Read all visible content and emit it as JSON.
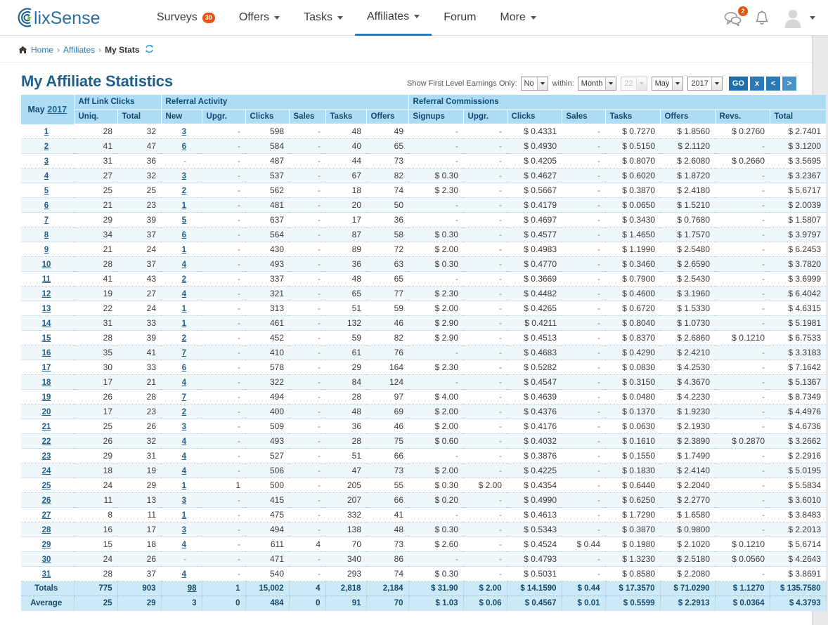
{
  "brand": {
    "name": "clixSense",
    "accent": "#2a7ab9",
    "badge_color": "#e8520e"
  },
  "nav": {
    "items": [
      {
        "label": "Surveys",
        "badge": "30",
        "caret": false,
        "active": false
      },
      {
        "label": "Offers",
        "badge": null,
        "caret": true,
        "active": false
      },
      {
        "label": "Tasks",
        "badge": null,
        "caret": true,
        "active": false
      },
      {
        "label": "Affiliates",
        "badge": null,
        "caret": true,
        "active": true
      },
      {
        "label": "Forum",
        "badge": null,
        "caret": false,
        "active": false
      },
      {
        "label": "More",
        "badge": null,
        "caret": true,
        "active": false
      }
    ],
    "chat_icon": "chat-bubbles-icon",
    "chat_count": "2",
    "bell_icon": "bell-icon",
    "avatar_icon": "user-avatar-icon"
  },
  "breadcrumb": {
    "home_icon": "home-icon",
    "home": "Home",
    "section": "Affiliates",
    "current": "My Stats",
    "refresh_icon": "refresh-icon",
    "separator": "›"
  },
  "header": {
    "title": "My Affiliate Statistics"
  },
  "filters": {
    "first_level_label": "Show First Level Earnings Only:",
    "first_level_value": "No",
    "within_label": "within:",
    "period_value": "Month",
    "day_value": "22",
    "day_disabled": true,
    "month_value": "May",
    "year_value": "2017",
    "go_label": "GO",
    "clear_label": "x",
    "prev_label": "<",
    "next_label": ">"
  },
  "table": {
    "month_label": "May",
    "year_label": "2017",
    "groups": [
      {
        "label": "Aff Link Clicks",
        "span": 2
      },
      {
        "label": "Referral Activity",
        "span": 6
      },
      {
        "label": "Referral Commissions",
        "span": 8
      }
    ],
    "columns": [
      "Uniq.",
      "Total",
      "New",
      "Upgr.",
      "Clicks",
      "Sales",
      "Tasks",
      "Offers",
      "Signups",
      "Upgr.",
      "Clicks",
      "Sales",
      "Tasks",
      "Offers",
      "Revs.",
      "Total"
    ],
    "rows": [
      {
        "day": "1",
        "cells": [
          "28",
          "32",
          "3",
          "-",
          "598",
          "-",
          "48",
          "49",
          "-",
          "-",
          "$ 0.4331",
          "-",
          "$ 0.7270",
          "$ 1.8560",
          "$ 0.2760",
          "$ 2.7401"
        ]
      },
      {
        "day": "2",
        "cells": [
          "41",
          "47",
          "6",
          "-",
          "584",
          "-",
          "40",
          "65",
          "-",
          "-",
          "$ 0.4930",
          "-",
          "$ 0.5150",
          "$ 2.1120",
          "-",
          "$ 3.1200"
        ]
      },
      {
        "day": "3",
        "cells": [
          "31",
          "36",
          "-",
          "-",
          "487",
          "-",
          "44",
          "73",
          "-",
          "-",
          "$ 0.4205",
          "-",
          "$ 0.8070",
          "$ 2.6080",
          "$ 0.2660",
          "$ 3.5695"
        ]
      },
      {
        "day": "4",
        "cells": [
          "27",
          "32",
          "3",
          "-",
          "537",
          "-",
          "67",
          "82",
          "$ 0.30",
          "-",
          "$ 0.4627",
          "-",
          "$ 0.6020",
          "$ 1.8720",
          "-",
          "$ 3.2367"
        ]
      },
      {
        "day": "5",
        "cells": [
          "25",
          "25",
          "2",
          "-",
          "562",
          "-",
          "18",
          "74",
          "$ 2.30",
          "-",
          "$ 0.5667",
          "-",
          "$ 0.3870",
          "$ 2.4180",
          "-",
          "$ 5.6717"
        ]
      },
      {
        "day": "6",
        "cells": [
          "21",
          "23",
          "1",
          "-",
          "481",
          "-",
          "20",
          "50",
          "-",
          "-",
          "$ 0.4179",
          "-",
          "$ 0.0650",
          "$ 1.5210",
          "-",
          "$ 2.0039"
        ]
      },
      {
        "day": "7",
        "cells": [
          "29",
          "39",
          "5",
          "-",
          "637",
          "-",
          "17",
          "36",
          "-",
          "-",
          "$ 0.4697",
          "-",
          "$ 0.3430",
          "$ 0.7680",
          "-",
          "$ 1.5807"
        ]
      },
      {
        "day": "8",
        "cells": [
          "34",
          "37",
          "6",
          "-",
          "564",
          "-",
          "87",
          "58",
          "$ 0.30",
          "-",
          "$ 0.4577",
          "-",
          "$ 1.4650",
          "$ 1.7570",
          "-",
          "$ 3.9797"
        ]
      },
      {
        "day": "9",
        "cells": [
          "21",
          "24",
          "1",
          "-",
          "430",
          "-",
          "89",
          "72",
          "$ 2.00",
          "-",
          "$ 0.4983",
          "-",
          "$ 1.1990",
          "$ 2.5480",
          "-",
          "$ 6.2453"
        ]
      },
      {
        "day": "10",
        "cells": [
          "28",
          "37",
          "4",
          "-",
          "493",
          "-",
          "36",
          "63",
          "$ 0.30",
          "-",
          "$ 0.4770",
          "-",
          "$ 0.3460",
          "$ 2.6590",
          "-",
          "$ 3.7820"
        ]
      },
      {
        "day": "11",
        "cells": [
          "41",
          "43",
          "2",
          "-",
          "337",
          "-",
          "48",
          "65",
          "-",
          "-",
          "$ 0.3669",
          "-",
          "$ 0.7900",
          "$ 2.5430",
          "-",
          "$ 3.6999"
        ]
      },
      {
        "day": "12",
        "cells": [
          "19",
          "27",
          "4",
          "-",
          "321",
          "-",
          "65",
          "77",
          "$ 2.30",
          "-",
          "$ 0.4482",
          "-",
          "$ 0.4600",
          "$ 3.1960",
          "-",
          "$ 6.4042"
        ]
      },
      {
        "day": "13",
        "cells": [
          "22",
          "24",
          "1",
          "-",
          "313",
          "-",
          "51",
          "59",
          "$ 2.00",
          "-",
          "$ 0.4265",
          "-",
          "$ 0.6720",
          "$ 1.5330",
          "-",
          "$ 4.6315"
        ]
      },
      {
        "day": "14",
        "cells": [
          "31",
          "33",
          "1",
          "-",
          "461",
          "-",
          "132",
          "46",
          "$ 2.90",
          "-",
          "$ 0.4211",
          "-",
          "$ 0.8040",
          "$ 1.0730",
          "-",
          "$ 5.1981"
        ]
      },
      {
        "day": "15",
        "cells": [
          "28",
          "39",
          "2",
          "-",
          "452",
          "-",
          "59",
          "82",
          "$ 2.90",
          "-",
          "$ 0.4513",
          "-",
          "$ 0.8370",
          "$ 2.6860",
          "$ 0.1210",
          "$ 6.7533"
        ]
      },
      {
        "day": "16",
        "cells": [
          "35",
          "41",
          "7",
          "-",
          "410",
          "-",
          "61",
          "76",
          "-",
          "-",
          "$ 0.4683",
          "-",
          "$ 0.4290",
          "$ 2.4210",
          "-",
          "$ 3.3183"
        ]
      },
      {
        "day": "17",
        "cells": [
          "30",
          "33",
          "6",
          "-",
          "578",
          "-",
          "29",
          "164",
          "$ 2.30",
          "-",
          "$ 0.5282",
          "-",
          "$ 0.0830",
          "$ 4.2530",
          "-",
          "$ 7.1642"
        ]
      },
      {
        "day": "18",
        "cells": [
          "17",
          "21",
          "4",
          "-",
          "322",
          "-",
          "84",
          "124",
          "-",
          "-",
          "$ 0.4547",
          "-",
          "$ 0.3150",
          "$ 4.3670",
          "-",
          "$ 5.1367"
        ]
      },
      {
        "day": "19",
        "cells": [
          "26",
          "28",
          "7",
          "-",
          "494",
          "-",
          "28",
          "97",
          "$ 4.00",
          "-",
          "$ 0.4639",
          "-",
          "$ 0.0480",
          "$ 4.2230",
          "-",
          "$ 8.7349"
        ]
      },
      {
        "day": "20",
        "cells": [
          "17",
          "23",
          "2",
          "-",
          "400",
          "-",
          "48",
          "69",
          "$ 2.00",
          "-",
          "$ 0.4376",
          "-",
          "$ 0.1370",
          "$ 1.9230",
          "-",
          "$ 4.4976"
        ]
      },
      {
        "day": "21",
        "cells": [
          "25",
          "26",
          "3",
          "-",
          "509",
          "-",
          "36",
          "46",
          "$ 2.00",
          "-",
          "$ 0.4176",
          "-",
          "$ 0.0630",
          "$ 2.1930",
          "-",
          "$ 4.6736"
        ]
      },
      {
        "day": "22",
        "cells": [
          "26",
          "32",
          "4",
          "-",
          "493",
          "-",
          "28",
          "75",
          "$ 0.60",
          "-",
          "$ 0.4032",
          "-",
          "$ 0.1610",
          "$ 2.3890",
          "$ 0.2870",
          "$ 3.2662"
        ]
      },
      {
        "day": "23",
        "cells": [
          "29",
          "31",
          "4",
          "-",
          "527",
          "-",
          "51",
          "66",
          "-",
          "-",
          "$ 0.3876",
          "-",
          "$ 0.1550",
          "$ 1.7490",
          "-",
          "$ 2.2916"
        ]
      },
      {
        "day": "24",
        "cells": [
          "18",
          "19",
          "4",
          "-",
          "506",
          "-",
          "47",
          "73",
          "$ 2.00",
          "-",
          "$ 0.4225",
          "-",
          "$ 0.1830",
          "$ 2.4140",
          "-",
          "$ 5.0195"
        ]
      },
      {
        "day": "25",
        "cells": [
          "24",
          "29",
          "1",
          "1",
          "500",
          "-",
          "205",
          "55",
          "$ 0.30",
          "$ 2.00",
          "$ 0.4354",
          "-",
          "$ 0.6440",
          "$ 2.2040",
          "-",
          "$ 5.5834"
        ]
      },
      {
        "day": "26",
        "cells": [
          "11",
          "13",
          "3",
          "-",
          "415",
          "-",
          "207",
          "66",
          "$ 0.20",
          "-",
          "$ 0.4990",
          "-",
          "$ 0.6250",
          "$ 2.2770",
          "-",
          "$ 3.6010"
        ]
      },
      {
        "day": "27",
        "cells": [
          "8",
          "11",
          "1",
          "-",
          "475",
          "-",
          "332",
          "41",
          "-",
          "-",
          "$ 0.4613",
          "-",
          "$ 1.7290",
          "$ 1.6580",
          "-",
          "$ 3.8483"
        ]
      },
      {
        "day": "28",
        "cells": [
          "16",
          "17",
          "3",
          "-",
          "494",
          "-",
          "138",
          "48",
          "$ 0.30",
          "-",
          "$ 0.5343",
          "-",
          "$ 0.3870",
          "$ 0.9800",
          "-",
          "$ 2.2013"
        ]
      },
      {
        "day": "29",
        "cells": [
          "15",
          "18",
          "4",
          "-",
          "611",
          "4",
          "70",
          "73",
          "$ 2.60",
          "-",
          "$ 0.4524",
          "$ 0.44",
          "$ 0.1980",
          "$ 2.1020",
          "$ 0.1210",
          "$ 5.6714"
        ]
      },
      {
        "day": "30",
        "cells": [
          "24",
          "26",
          "-",
          "-",
          "471",
          "-",
          "340",
          "86",
          "-",
          "-",
          "$ 0.4793",
          "-",
          "$ 1.3230",
          "$ 2.5180",
          "$ 0.0560",
          "$ 4.2643"
        ]
      },
      {
        "day": "31",
        "cells": [
          "28",
          "37",
          "4",
          "-",
          "540",
          "-",
          "293",
          "74",
          "$ 0.30",
          "-",
          "$ 0.5031",
          "-",
          "$ 0.8580",
          "$ 2.2080",
          "-",
          "$ 3.8691"
        ]
      }
    ],
    "totals": {
      "label": "Totals",
      "cells": [
        "775",
        "903",
        "98",
        "1",
        "15,002",
        "4",
        "2,818",
        "2,184",
        "$ 31.90",
        "$ 2.00",
        "$ 14.1590",
        "$ 0.44",
        "$ 17.3570",
        "$ 71.0290",
        "$ 1.1270",
        "$ 135.7580"
      ]
    },
    "average": {
      "label": "Average",
      "cells": [
        "25",
        "29",
        "3",
        "0",
        "484",
        "0",
        "91",
        "70",
        "$ 1.03",
        "$ 0.06",
        "$ 0.4567",
        "$ 0.01",
        "$ 0.5599",
        "$ 2.2913",
        "$ 0.0364",
        "$ 4.3793"
      ]
    }
  }
}
